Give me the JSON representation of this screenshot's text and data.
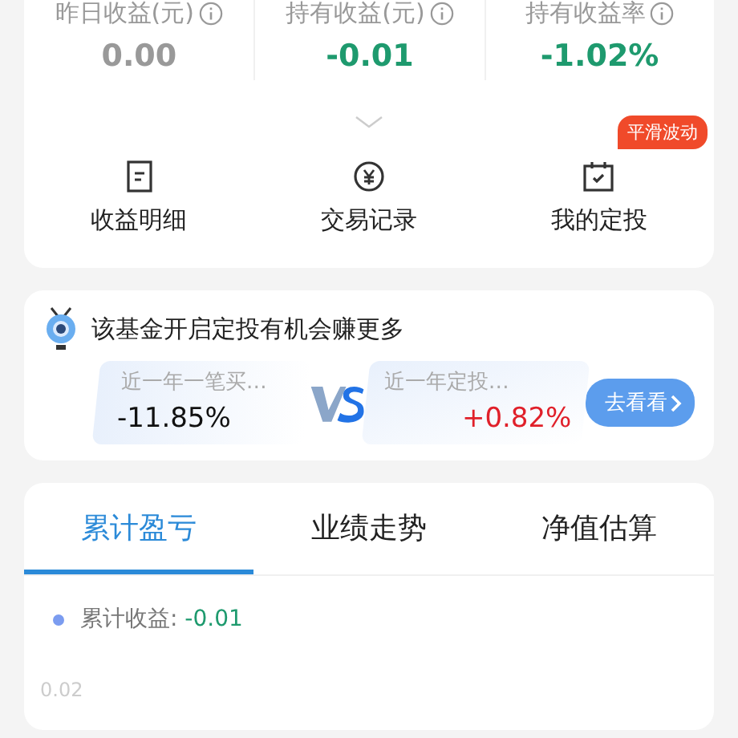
{
  "summary": {
    "stats": [
      {
        "label": "昨日收益(元)",
        "value": "0.00",
        "color": "#999999"
      },
      {
        "label": "持有收益(元)",
        "value": "-0.01",
        "color": "#1e9a6e"
      },
      {
        "label": "持有收益率",
        "value": "-1.02%",
        "color": "#1e9a6e"
      }
    ],
    "actions": [
      {
        "kind": "list",
        "label": "收益明细"
      },
      {
        "kind": "yuan",
        "label": "交易记录"
      },
      {
        "kind": "calendar",
        "label": "我的定投",
        "badge": "平滑波动"
      }
    ]
  },
  "promo": {
    "title": "该基金开启定投有机会赚更多",
    "comparisons": [
      {
        "label": "近一年一笔买…",
        "value": "-11.85%",
        "color": "#111111"
      },
      {
        "label": "近一年定投…",
        "value": "+0.82%",
        "color": "#e0202a"
      }
    ],
    "button": "去看看"
  },
  "tabs": [
    {
      "label": "累计盈亏",
      "selected": true
    },
    {
      "label": "业绩走势",
      "selected": false
    },
    {
      "label": "净值估算",
      "selected": false
    }
  ],
  "chart": {
    "legend": {
      "label": "累计收益:",
      "value": "-0.01",
      "color": "#7b9cf0"
    },
    "ytick": "0.02"
  }
}
